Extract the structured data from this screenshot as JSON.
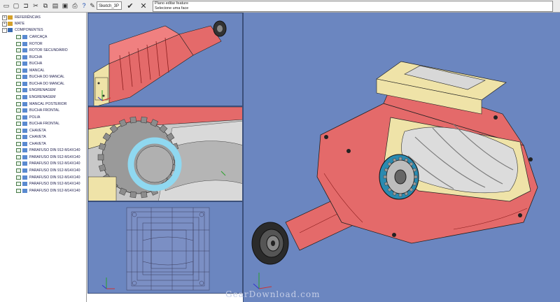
{
  "toolbar": {
    "sketch_label": "Sketch_3P",
    "message_line1": "Plano editar feature",
    "message_line2": "Selecione uma face"
  },
  "tree": {
    "groups": [
      {
        "label": "REFERÊNCIAS"
      },
      {
        "label": "MATE"
      },
      {
        "label": "COMPONENTES"
      }
    ],
    "components": [
      {
        "label": "CARCAÇA"
      },
      {
        "label": "ROTOR"
      },
      {
        "label": "ROTOR SECUNDÁRIO"
      },
      {
        "label": "BUCHA"
      },
      {
        "label": "BUCHA"
      },
      {
        "label": "MANCAL"
      },
      {
        "label": "BUCHA DO MANCAL"
      },
      {
        "label": "BUCHA DO MANCAL"
      },
      {
        "label": "ENGRENAGEM"
      },
      {
        "label": "ENGRENAGEM"
      },
      {
        "label": "MANCAL POSTERIOR"
      },
      {
        "label": "BUCHA FRONTAL"
      },
      {
        "label": "POLIA"
      },
      {
        "label": "BUCHA FRONTAL"
      },
      {
        "label": "CHAVETA"
      },
      {
        "label": "CHAVETA"
      },
      {
        "label": "CHAVETA"
      },
      {
        "label": "PARAFUSO DIN 912-M14X140"
      },
      {
        "label": "PARAFUSO DIN 912-M14X140"
      },
      {
        "label": "PARAFUSO DIN 912-M14X140"
      },
      {
        "label": "PARAFUSO DIN 912-M14X140"
      },
      {
        "label": "PARAFUSO DIN 912-M14X140"
      },
      {
        "label": "PARAFUSO DIN 912-M14X140"
      },
      {
        "label": "PARAFUSO DIN 912-M14X140"
      }
    ]
  },
  "watermark": "GearDownload.com",
  "colors": {
    "viewport_bg": "#6b86c0",
    "part_red": "#e46a6a",
    "part_cream": "#efe3a8",
    "part_steel": "#cfcfcf"
  }
}
